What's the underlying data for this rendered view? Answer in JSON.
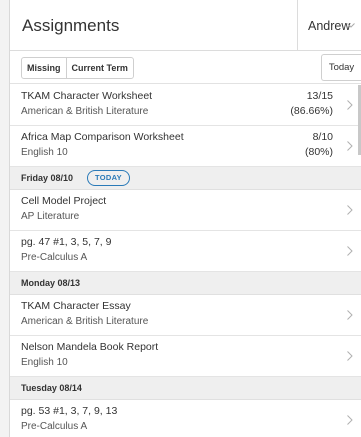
{
  "header": {
    "title": "Assignments",
    "user_name": "Andrew"
  },
  "filters": {
    "missing_label": "Missing",
    "current_term_label": "Current Term",
    "today_label": "Today"
  },
  "graded": [
    {
      "title": "TKAM Character Worksheet",
      "course": "American & British Literature",
      "score": "13/15",
      "percent": "(86.66%)"
    },
    {
      "title": "Africa Map Comparison Worksheet",
      "course": "English 10",
      "score": "8/10",
      "percent": "(80%)"
    }
  ],
  "days": [
    {
      "label": "Friday 08/10",
      "badge": "TODAY",
      "items": [
        {
          "title": "Cell Model Project",
          "course": "AP Literature"
        },
        {
          "title": "pg. 47 #1, 3, 5, 7, 9",
          "course": "Pre-Calculus A"
        }
      ]
    },
    {
      "label": "Monday 08/13",
      "items": [
        {
          "title": "TKAM Character Essay",
          "course": "American & British Literature"
        },
        {
          "title": "Nelson Mandela Book Report",
          "course": "English 10"
        }
      ]
    },
    {
      "label": "Tuesday 08/14",
      "items": [
        {
          "title": "pg. 53 #1, 3, 7, 9, 13",
          "course": "Pre-Calculus A"
        }
      ]
    }
  ],
  "icons": {
    "user_menu": "chevron-down-icon",
    "row_arrow": "chevron-right-icon"
  }
}
